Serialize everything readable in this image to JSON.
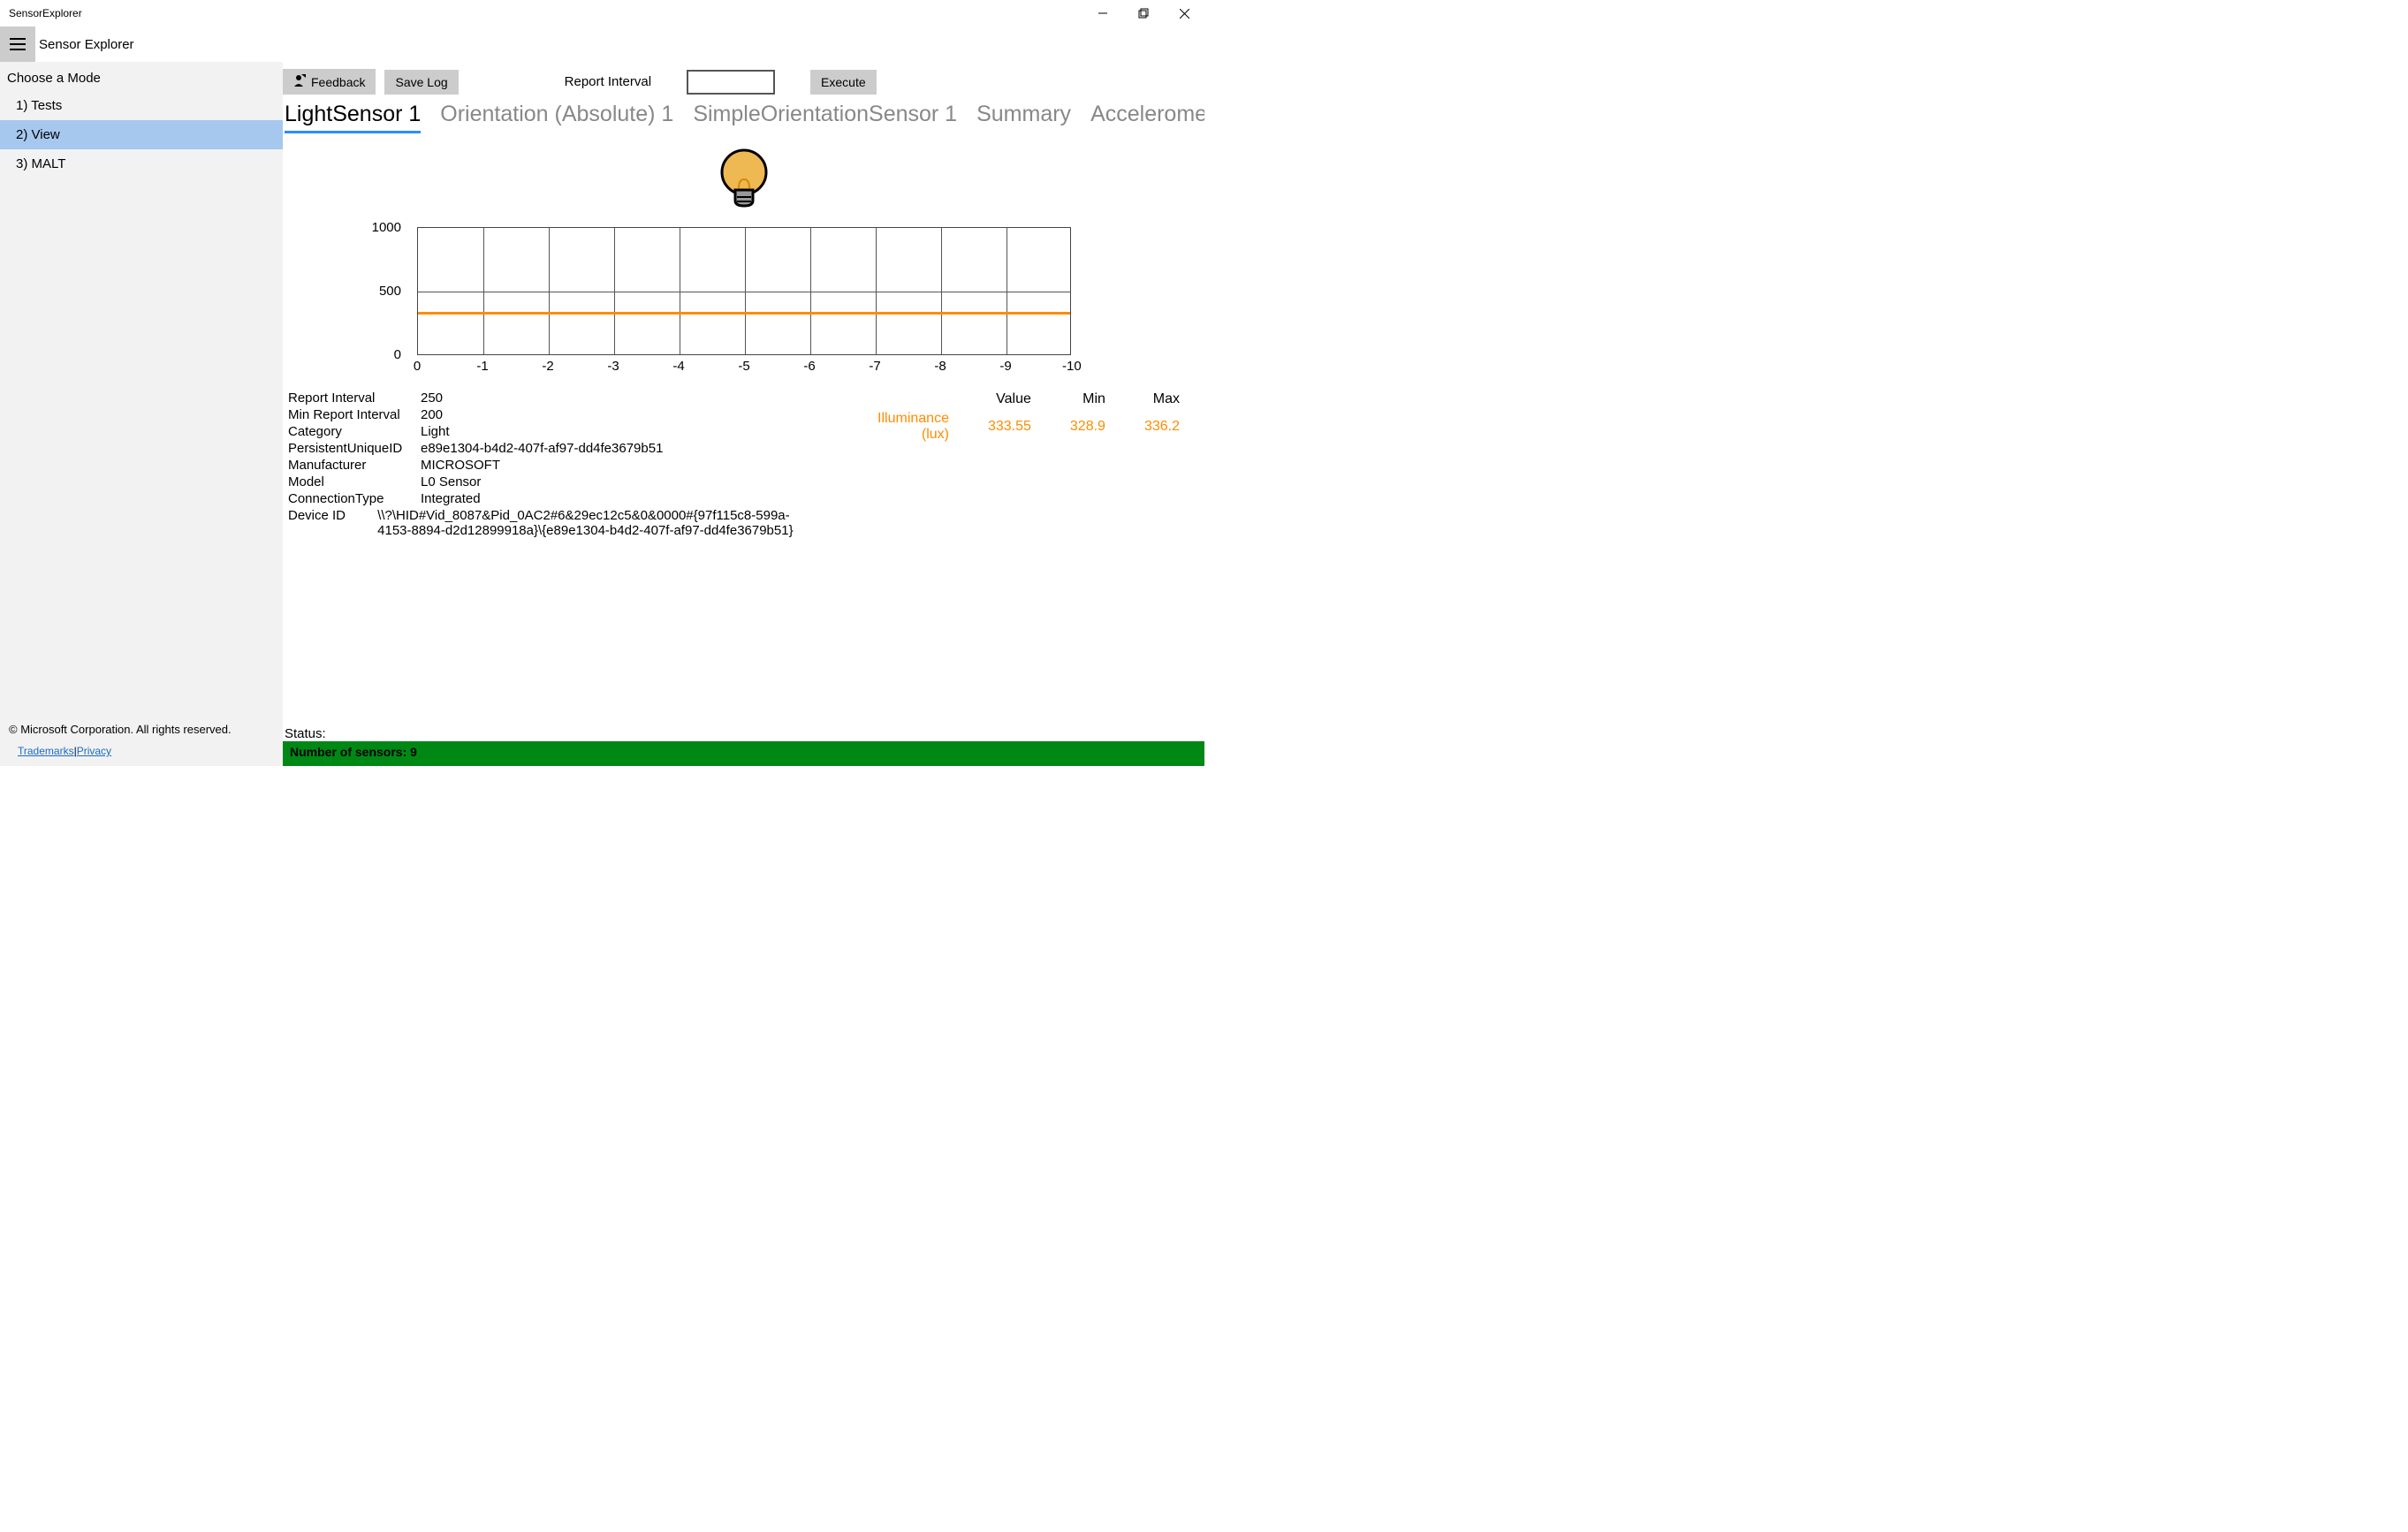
{
  "window": {
    "title": "SensorExplorer"
  },
  "app": {
    "title": "Sensor Explorer"
  },
  "sidebar": {
    "choose_label": "Choose a Mode",
    "items": [
      {
        "label": "1) Tests"
      },
      {
        "label": "2) View",
        "selected": true
      },
      {
        "label": "3) MALT"
      }
    ],
    "copyright": "© Microsoft Corporation. All rights reserved.",
    "trademarks": "Trademarks",
    "sep": "|",
    "privacy": "Privacy"
  },
  "toolbar": {
    "feedback": "Feedback",
    "savelog": "Save Log",
    "report_interval_label": "Report Interval",
    "execute": "Execute"
  },
  "tabs": [
    "LightSensor 1",
    "Orientation (Absolute) 1",
    "SimpleOrientationSensor 1",
    "Summary",
    "Accelerometer (Sta"
  ],
  "chart_data": {
    "type": "line",
    "title": "",
    "xlabel": "",
    "ylabel": "",
    "ylim": [
      0,
      1000
    ],
    "yticks": [
      0,
      500,
      1000
    ],
    "xticks": [
      "0",
      "-1",
      "-2",
      "-3",
      "-4",
      "-5",
      "-6",
      "-7",
      "-8",
      "-9",
      "-10"
    ],
    "series": [
      {
        "name": "Illuminance (lux)",
        "values": [
          333.55,
          333.55,
          333.55,
          333.55,
          333.55,
          333.55,
          333.55,
          333.55,
          333.55,
          333.55,
          333.55
        ]
      }
    ]
  },
  "properties": [
    {
      "k": "Report Interval",
      "v": "250"
    },
    {
      "k": "Min Report Interval",
      "v": "200"
    },
    {
      "k": "Category",
      "v": "Light"
    },
    {
      "k": "PersistentUniqueID",
      "v": "e89e1304-b4d2-407f-af97-dd4fe3679b51"
    },
    {
      "k": "Manufacturer",
      "v": "MICROSOFT"
    },
    {
      "k": "Model",
      "v": "L0 Sensor"
    },
    {
      "k": "ConnectionType",
      "v": "Integrated"
    },
    {
      "k": "Device ID",
      "v": "\\\\?\\HID#Vid_8087&Pid_0AC2#6&29ec12c5&0&0000#{97f115c8-599a-4153-8894-d2d12899918a}\\{e89e1304-b4d2-407f-af97-dd4fe3679b51}"
    }
  ],
  "measure": {
    "headers": [
      "Value",
      "Min",
      "Max"
    ],
    "label": "Illuminance (lux)",
    "value": "333.55",
    "min": "328.9",
    "max": "336.2"
  },
  "status": {
    "label": "Status:"
  },
  "sensorcount": "Number of sensors: 9"
}
